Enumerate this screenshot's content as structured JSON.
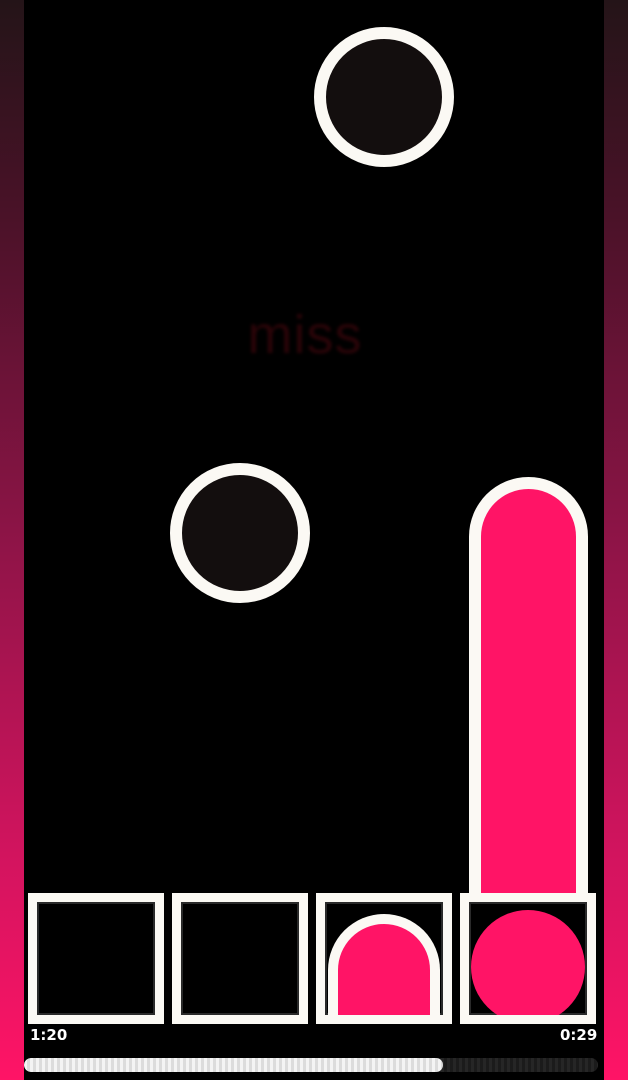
{
  "game": {
    "judgement_text": "miss",
    "time_elapsed": "1:20",
    "time_remaining": "0:29",
    "progress_fraction": 0.73,
    "lanes": [
      {
        "id": 1,
        "pressed": false
      },
      {
        "id": 2,
        "pressed": false
      },
      {
        "id": 3,
        "pressed": true
      },
      {
        "id": 4,
        "pressed": true
      }
    ]
  },
  "colors": {
    "accent": "#ff1466",
    "note_fill": "#130e0e",
    "note_outline": "#fbf9f4",
    "background": "#000000"
  }
}
